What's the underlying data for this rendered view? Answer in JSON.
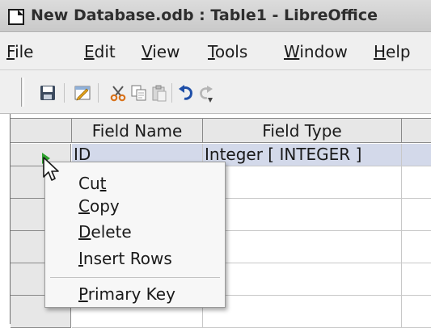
{
  "window": {
    "title": "New Database.odb : Table1 - LibreOffice"
  },
  "menubar": {
    "items": [
      {
        "label": "File",
        "mnemonic": "F",
        "rest": "ile"
      },
      {
        "label": "Edit",
        "mnemonic": "E",
        "rest": "dit"
      },
      {
        "label": "View",
        "mnemonic": "V",
        "rest": "iew"
      },
      {
        "label": "Tools",
        "mnemonic": "T",
        "rest": "ools"
      },
      {
        "label": "Window",
        "mnemonic": "W",
        "rest": "indow"
      },
      {
        "label": "Help",
        "mnemonic": "H",
        "rest": "elp"
      }
    ]
  },
  "toolbar": {
    "icons": [
      "save-icon",
      "edit-icon",
      "cut-icon",
      "copy-icon",
      "paste-icon",
      "undo-icon",
      "redo-icon"
    ]
  },
  "table": {
    "columns": [
      "Field Name",
      "Field Type"
    ],
    "rows": [
      {
        "field_name": "ID",
        "field_type": "Integer [ INTEGER ]",
        "selected": true
      }
    ]
  },
  "context_menu": {
    "items": [
      {
        "label": "Cut",
        "before": "Cu",
        "mnemonic": "t",
        "after": ""
      },
      {
        "label": "Copy",
        "before": "",
        "mnemonic": "C",
        "after": "opy"
      },
      {
        "label": "Delete",
        "before": "",
        "mnemonic": "D",
        "after": "elete"
      },
      {
        "label": "Insert Rows",
        "before": "",
        "mnemonic": "I",
        "after": "nsert Rows"
      },
      {
        "label": "Primary Key",
        "before": "",
        "mnemonic": "P",
        "after": "rimary Key"
      }
    ]
  },
  "colors": {
    "selection_row": "#d3d9ea",
    "header_bg": "#e7e7e7",
    "row_indicator": "#2ea22e"
  }
}
